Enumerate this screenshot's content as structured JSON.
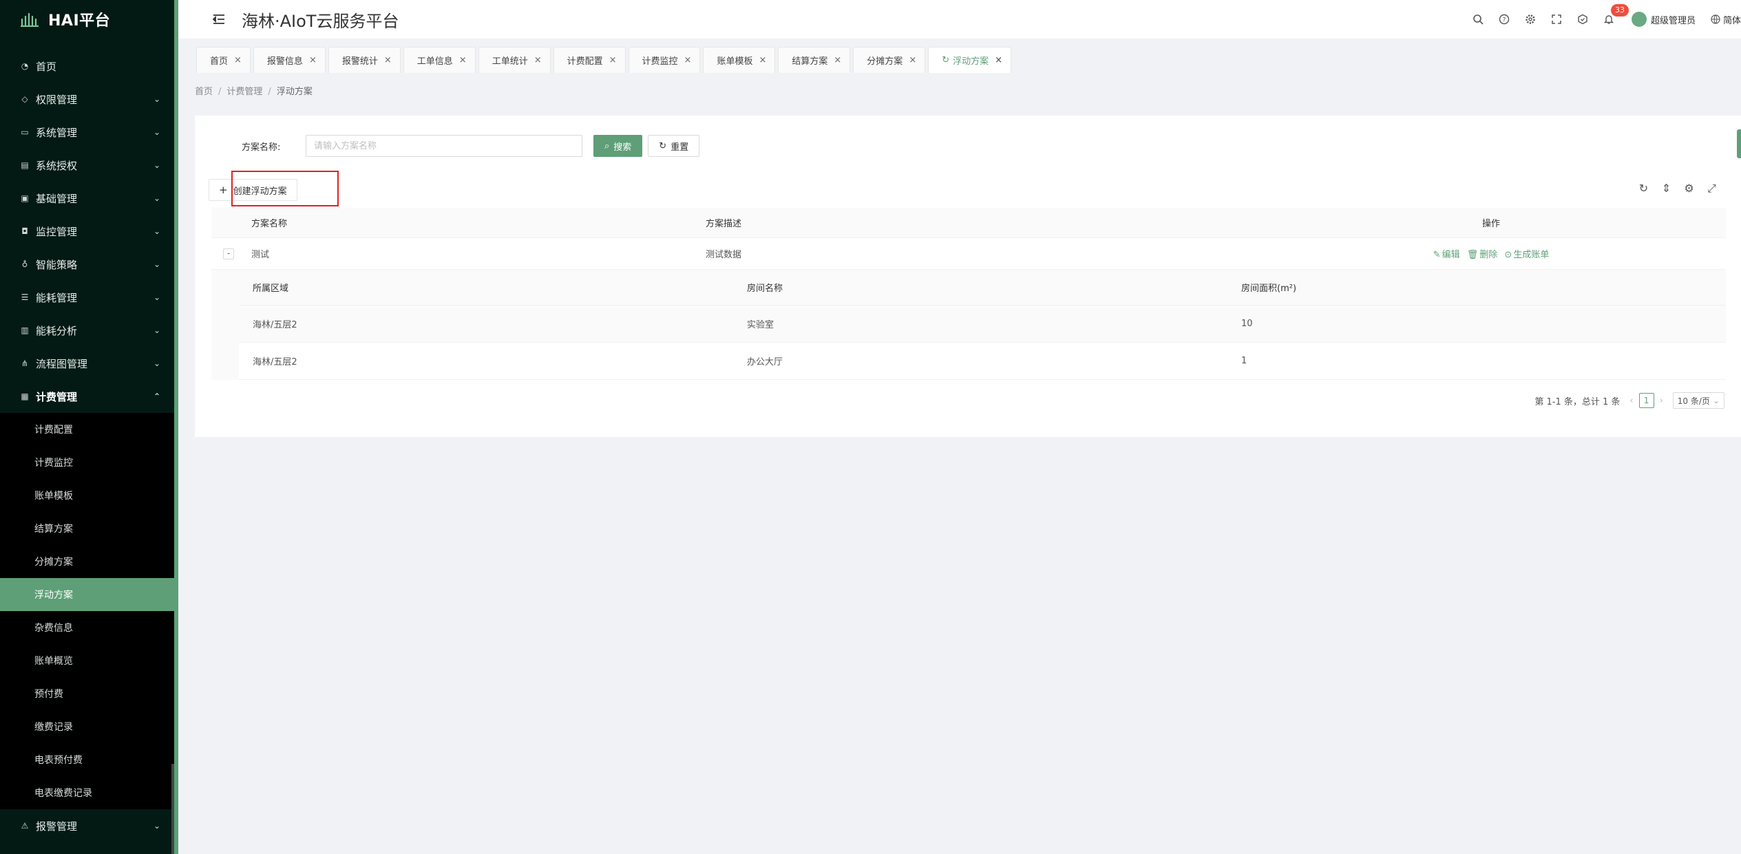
{
  "brand": {
    "name": "HAI平台"
  },
  "app_title": "海林·AIoT云服务平台",
  "header": {
    "notification_count": "33",
    "user_name": "超级管理员",
    "language": "简体"
  },
  "sidebar": {
    "items": [
      {
        "label": "首页",
        "icon": "dashboard-icon"
      },
      {
        "label": "权限管理",
        "icon": "shield-icon"
      },
      {
        "label": "系统管理",
        "icon": "monitor-icon"
      },
      {
        "label": "系统授权",
        "icon": "document-icon"
      },
      {
        "label": "基础管理",
        "icon": "card-icon"
      },
      {
        "label": "监控管理",
        "icon": "camera-icon"
      },
      {
        "label": "智能策略",
        "icon": "bulb-icon"
      },
      {
        "label": "能耗管理",
        "icon": "sliders-icon"
      },
      {
        "label": "能耗分析",
        "icon": "bar-chart-icon"
      },
      {
        "label": "流程图管理",
        "icon": "flow-icon"
      },
      {
        "label": "计费管理",
        "icon": "billing-icon"
      }
    ],
    "billing_subitems": [
      {
        "label": "计费配置"
      },
      {
        "label": "计费监控"
      },
      {
        "label": "账单模板"
      },
      {
        "label": "结算方案"
      },
      {
        "label": "分摊方案"
      },
      {
        "label": "浮动方案"
      },
      {
        "label": "杂费信息"
      },
      {
        "label": "账单概览"
      },
      {
        "label": "预付费"
      },
      {
        "label": "缴费记录"
      },
      {
        "label": "电表预付费"
      },
      {
        "label": "电表缴费记录"
      }
    ],
    "bottom_item": {
      "label": "报警管理",
      "icon": "alarm-icon"
    }
  },
  "tabs": [
    {
      "label": "首页"
    },
    {
      "label": "报警信息"
    },
    {
      "label": "报警统计"
    },
    {
      "label": "工单信息"
    },
    {
      "label": "工单统计"
    },
    {
      "label": "计费配置"
    },
    {
      "label": "计费监控"
    },
    {
      "label": "账单模板"
    },
    {
      "label": "结算方案"
    },
    {
      "label": "分摊方案"
    },
    {
      "label": "浮动方案"
    }
  ],
  "breadcrumb": {
    "level1": "首页",
    "level2": "计费管理",
    "level3": "浮动方案"
  },
  "search": {
    "label": "方案名称:",
    "placeholder": "请输入方案名称",
    "value": "",
    "search_button": "搜索",
    "reset_button": "重置"
  },
  "toolbar": {
    "create_button": "创建浮动方案"
  },
  "table": {
    "headers": {
      "name": "方案名称",
      "description": "方案描述",
      "actions": "操作"
    },
    "rows": [
      {
        "expand_symbol": "-",
        "name": "测试",
        "description": "测试数据",
        "actions": {
          "edit": "编辑",
          "delete": "删除",
          "generate": "生成账单"
        }
      }
    ],
    "nested": {
      "headers": {
        "area": "所属区域",
        "room": "房间名称",
        "size": "房间面积(m²)"
      },
      "rows": [
        {
          "area": "海林/五层2",
          "room": "实验室",
          "size": "10"
        },
        {
          "area": "海林/五层2",
          "room": "办公大厅",
          "size": "1"
        }
      ]
    }
  },
  "pagination": {
    "summary": "第 1-1 条，总计 1 条",
    "current_page": "1",
    "page_size": "10 条/页"
  },
  "colors": {
    "accent": "#5e9f77",
    "sidebar_bg": "#031a14",
    "highlight_box": "#e02020",
    "badge": "#ef4e3c"
  }
}
